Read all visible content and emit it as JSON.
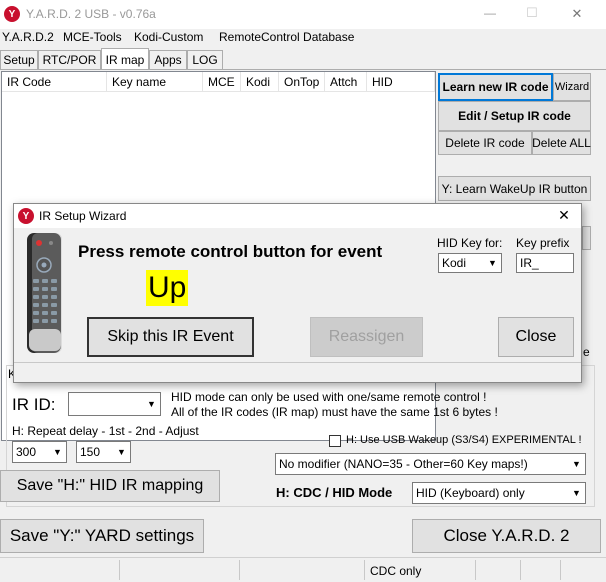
{
  "window": {
    "title": "Y.A.R.D. 2 USB - v0.76a",
    "minimize_glyph": "—",
    "maximize_glyph": "☐",
    "close_glyph": "✕"
  },
  "menu": [
    "Y.A.R.D.2",
    "MCE-Tools",
    "Kodi-Custom",
    "RemoteControl Database"
  ],
  "tabs": [
    "Setup",
    "RTC/POR",
    "IR map",
    "Apps",
    "LOG"
  ],
  "active_tab": "IR map",
  "ir_table": {
    "columns": [
      "IR Code",
      "Key name",
      "MCE",
      "Kodi",
      "OnTop",
      "Attch",
      "HID"
    ],
    "rows": []
  },
  "right_panel": {
    "learn_new": "Learn new IR code",
    "wizard": "Wizard",
    "edit_setup": "Edit / Setup IR code",
    "delete_ir": "Delete IR code",
    "delete_all": "Delete ALL",
    "learn_wakeup": "Y: Learn WakeUp IR button"
  },
  "dialog": {
    "title": "IR Setup Wizard",
    "close_glyph": "✕",
    "prompt": "Press remote control button for event",
    "event_name": "Up",
    "hid_key_for_label": "HID Key for:",
    "hid_key_for_value": "Kodi",
    "key_prefix_label": "Key prefix",
    "key_prefix_value": "IR_",
    "skip_button": "Skip this IR Event",
    "reassign_button": "Reassigen",
    "close_button": "Close"
  },
  "hid_section": {
    "ir_id_label": "IR ID:",
    "ir_id_value": "",
    "info_line1": "HID mode can only be used with one/same remote control !",
    "info_line2": "All of the IR codes (IR map) must have the same 1st 6 bytes !",
    "repeat_label": "H: Repeat delay - 1st - 2nd - Adjust",
    "repeat_first": "300",
    "repeat_second": "150",
    "usb_wakeup_label": "H: Use USB Wakeup (S3/S4) EXPERIMENTAL !",
    "modifier_value": "No  modifier (NANO=35 - Other=60 Key maps!)",
    "save_hid_button": "Save \"H:\" HID IR mapping",
    "cdc_hid_label": "H: CDC / HID Mode",
    "cdc_hid_value": "HID  (Keyboard) only",
    "partial_letter": "K"
  },
  "bottom": {
    "save_yard": "Save \"Y:\" YARD settings",
    "close_yard": "Close Y.A.R.D. 2"
  },
  "statusbar": {
    "cdc": "CDC only"
  },
  "colors": {
    "accent": "#0078d7",
    "event_highlight": "#ffff00",
    "app_icon": "#c8102e"
  }
}
